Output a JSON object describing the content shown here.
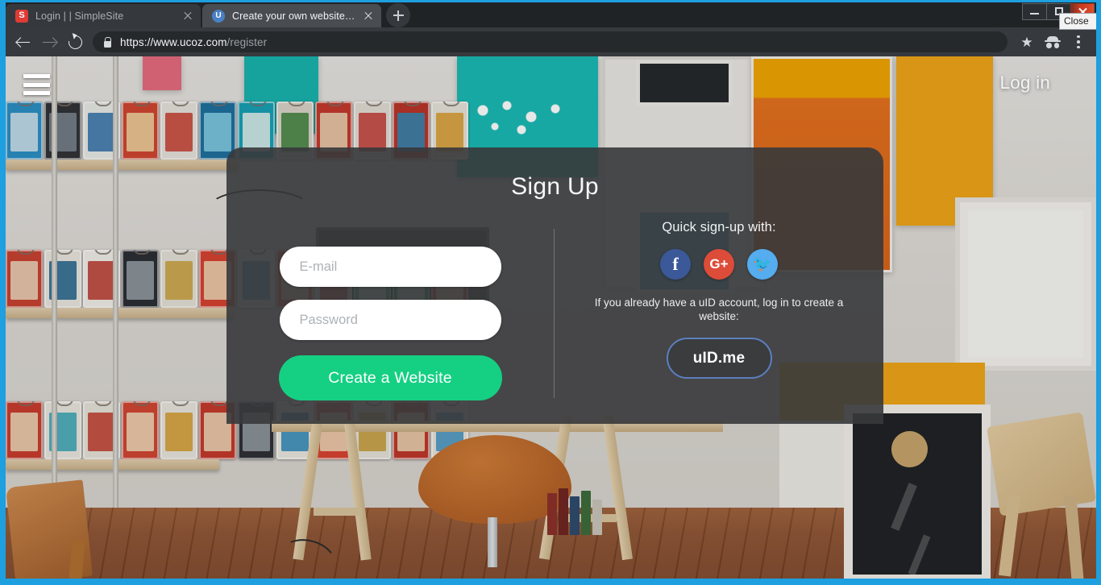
{
  "browser": {
    "tabs": [
      {
        "title": "Login | | SimpleSite",
        "favicon": "simplesite-favicon",
        "favicon_letter": "S",
        "active": false
      },
      {
        "title": "Create your own website - uCoz",
        "favicon": "ucoz-favicon",
        "favicon_letter": "U",
        "active": true
      }
    ],
    "new_tab_label": "+",
    "window_controls": {
      "minimize": "minimize",
      "maximize": "maximize",
      "close": "close",
      "tooltip": "Close"
    },
    "toolbar": {
      "back": "back-arrow",
      "forward": "forward-arrow",
      "reload": "reload",
      "lock": "secure-lock",
      "url_domain": "https://www.ucoz.com",
      "url_path": "/register",
      "bookmark": "★",
      "incognito": "incognito-profile",
      "menu": "kebab-menu"
    }
  },
  "page": {
    "header": {
      "menu_button": "hamburger-menu",
      "login_label": "Log in"
    },
    "card": {
      "title": "Sign Up",
      "email": {
        "placeholder": "E-mail",
        "value": ""
      },
      "password": {
        "placeholder": "Password",
        "value": ""
      },
      "submit_label": "Create a Website",
      "quick_signup_label": "Quick sign-up with:",
      "social": [
        {
          "name": "facebook",
          "glyph": "f",
          "color": "#3b5998"
        },
        {
          "name": "google-plus",
          "glyph": "G+",
          "color": "#dd4b39"
        },
        {
          "name": "twitter",
          "glyph": "🐦",
          "color": "#55acee"
        }
      ],
      "uid_note": "If you already have a uID account, log in to create a website:",
      "uid_button_label": "uID.me"
    }
  },
  "colors": {
    "accent_green": "#15d083",
    "uid_border_blue": "#5b7fc0",
    "window_border_blue": "#1e9fe0",
    "card_background": "rgba(55,57,59,.90)"
  }
}
